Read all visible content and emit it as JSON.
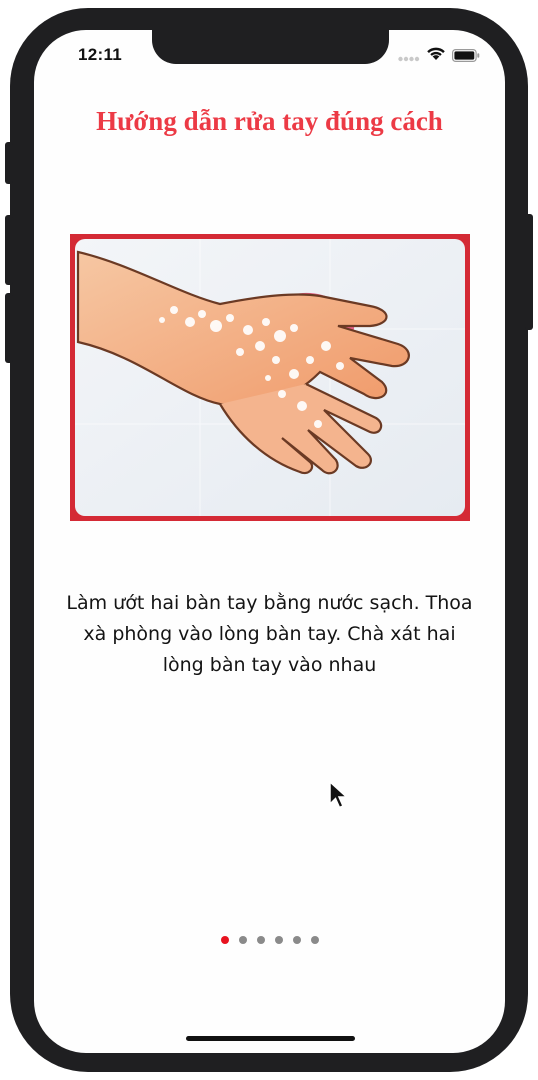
{
  "status_bar": {
    "time": "12:11"
  },
  "title": "Hướng dẫn rửa tay đúng cách",
  "step": {
    "illustration_icon": "washing-hands-with-soap",
    "description": "Làm ướt hai bàn tay bằng nước sạch. Thoa xà phòng vào lòng bàn tay. Chà xát hai lòng bàn tay vào nhau"
  },
  "pager": {
    "total_pages": 6,
    "current_page": 1
  },
  "colors": {
    "title": "#ec3a45",
    "frame_border": "#d42a35",
    "active_dot": "#e8121f",
    "inactive_dot": "#8a8a8a"
  }
}
